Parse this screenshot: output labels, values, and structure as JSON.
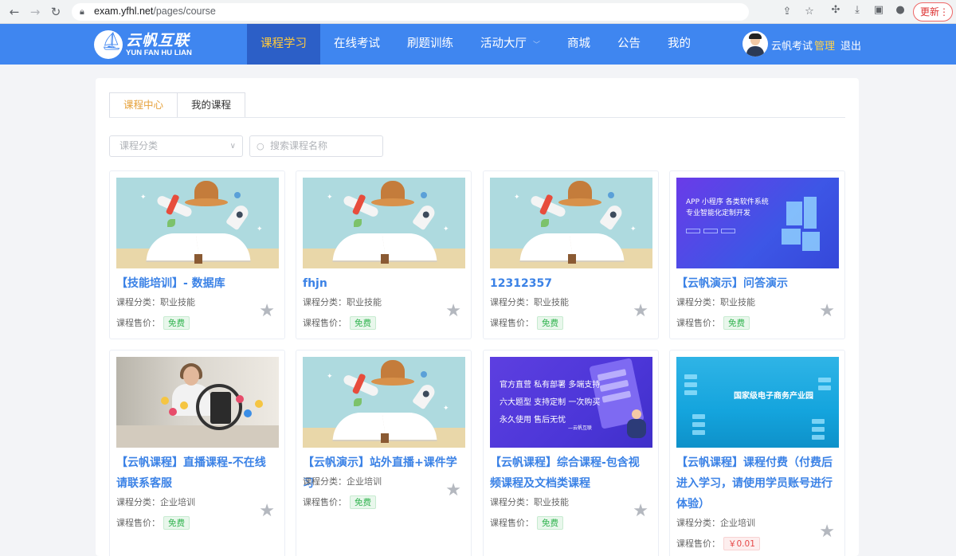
{
  "browser": {
    "url_host": "exam.yfhl.net",
    "url_path": "/pages/course",
    "update_label": "更新"
  },
  "site": {
    "logo_cn": "云帆互联",
    "logo_en": "YUN FAN HU LIAN",
    "nav": [
      {
        "label": "课程学习",
        "active": true
      },
      {
        "label": "在线考试"
      },
      {
        "label": "刷题训练"
      },
      {
        "label": "活动大厅",
        "has_dropdown": true
      },
      {
        "label": "商城"
      },
      {
        "label": "公告"
      },
      {
        "label": "我的"
      }
    ],
    "user": {
      "name": "云帆考试",
      "admin": "管理",
      "logout": "退出"
    }
  },
  "tabs": [
    {
      "label": "课程中心",
      "active": true
    },
    {
      "label": "我的课程"
    }
  ],
  "filters": {
    "category_placeholder": "课程分类",
    "search_placeholder": "搜索课程名称"
  },
  "labels": {
    "category": "课程分类：",
    "price": "课程售价："
  },
  "courses": [
    {
      "title": "【技能培训】- 数据库",
      "category": "职业技能",
      "price": "免费",
      "thumb": "book"
    },
    {
      "title": "fhjn",
      "category": "职业技能",
      "price": "免费",
      "thumb": "book"
    },
    {
      "title": "12312357",
      "category": "职业技能",
      "price": "免费",
      "thumb": "book"
    },
    {
      "title": "【云帆演示】问答演示",
      "category": "职业技能",
      "price": "免费",
      "thumb": "app"
    },
    {
      "title": "【云帆课程】直播课程-不在线请联系客服",
      "category": "企业培训",
      "price": "免费",
      "thumb": "photo"
    },
    {
      "title": "【云帆演示】站外直播+课件学习",
      "category": "企业培训",
      "price": "免费",
      "thumb": "book"
    },
    {
      "title": "【云帆课程】综合课程-包含视频课程及文档类课程",
      "category": "职业技能",
      "price": "免费",
      "thumb": "live"
    },
    {
      "title": "【云帆课程】课程付费（付费后进入学习，请使用学员账号进行体验）",
      "category": "企业培训",
      "price": "￥0.01",
      "thumb": "park"
    }
  ],
  "thumb_text": {
    "app_line1": "APP 小程序 各类软件系统",
    "app_line2": "专业智能化定制开发",
    "live_lines": [
      "官方直营 私有部署 多端支持",
      "六大题型 支持定制 一次购买",
      "永久使用 售后无忧"
    ],
    "live_sign": "—云帆互联",
    "park_title": "国家级电子商务产业园"
  },
  "colors": {
    "header_bg": "#3f86f0",
    "nav_active_bg": "#2c5fc7",
    "nav_active_text": "#ffc93c",
    "title_blue": "#3b82e6",
    "free_green": "#2fb34e",
    "paid_red": "#e64848"
  },
  "icons": {
    "back": "arrow-left-icon",
    "forward": "arrow-right-icon",
    "reload": "reload-icon",
    "lock": "lock-icon",
    "share": "share-icon",
    "bookmark": "star-outline-icon",
    "extensions": "puzzle-icon",
    "download": "download-icon",
    "sidebar": "sidebar-icon",
    "profile": "profile-icon",
    "favorite": "star-icon"
  }
}
